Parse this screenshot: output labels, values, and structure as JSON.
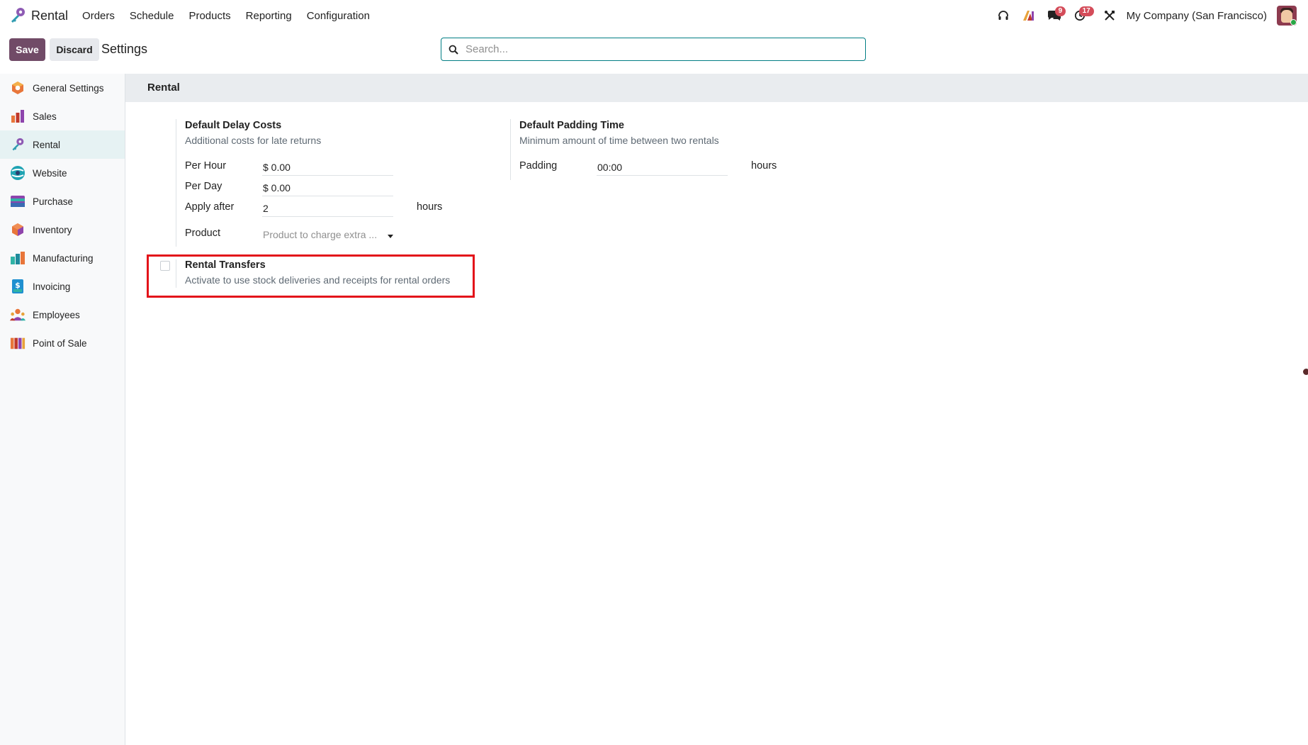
{
  "app": {
    "name": "Rental",
    "logo_icon": "rental-key-icon"
  },
  "menu": [
    "Orders",
    "Schedule",
    "Products",
    "Reporting",
    "Configuration"
  ],
  "systray": {
    "icons": [
      "headset-icon",
      "ai-icon",
      "chat-icon",
      "activity-clock-icon",
      "debug-tools-icon"
    ],
    "messages_badge": "9",
    "activities_badge": "17",
    "company": "My Company (San Francisco)",
    "avatar_icon": "user-avatar"
  },
  "controls": {
    "save_label": "Save",
    "discard_label": "Discard",
    "title": "Settings",
    "search_placeholder": "Search..."
  },
  "sidebar": {
    "active": "Rental",
    "items": [
      {
        "label": "General Settings",
        "icon": "general-settings-icon"
      },
      {
        "label": "Sales",
        "icon": "sales-icon"
      },
      {
        "label": "Rental",
        "icon": "rental-icon"
      },
      {
        "label": "Website",
        "icon": "website-icon"
      },
      {
        "label": "Purchase",
        "icon": "purchase-icon"
      },
      {
        "label": "Inventory",
        "icon": "inventory-icon"
      },
      {
        "label": "Manufacturing",
        "icon": "manufacturing-icon"
      },
      {
        "label": "Invoicing",
        "icon": "invoicing-icon"
      },
      {
        "label": "Employees",
        "icon": "employees-icon"
      },
      {
        "label": "Point of Sale",
        "icon": "point-of-sale-icon"
      }
    ]
  },
  "section": {
    "title": "Rental"
  },
  "delay_costs": {
    "title": "Default Delay Costs",
    "description": "Additional costs for late returns",
    "per_hour_label": "Per Hour",
    "per_hour_value": "$ 0.00",
    "per_day_label": "Per Day",
    "per_day_value": "$ 0.00",
    "apply_after_label": "Apply after",
    "apply_after_value": "2",
    "apply_after_unit": "hours",
    "product_label": "Product",
    "product_placeholder": "Product to charge extra ..."
  },
  "padding_time": {
    "title": "Default Padding Time",
    "description": "Minimum amount of time between two rentals",
    "padding_label": "Padding",
    "padding_value": "00:00",
    "padding_unit": "hours"
  },
  "rental_transfers": {
    "title": "Rental Transfers",
    "description": "Activate to use stock deliveries and receipts for rental orders",
    "checked": false,
    "highlight_color": "#e3131a"
  },
  "colors": {
    "brand": "#714b67",
    "accent": "#017e84",
    "badge": "#d44c59"
  }
}
